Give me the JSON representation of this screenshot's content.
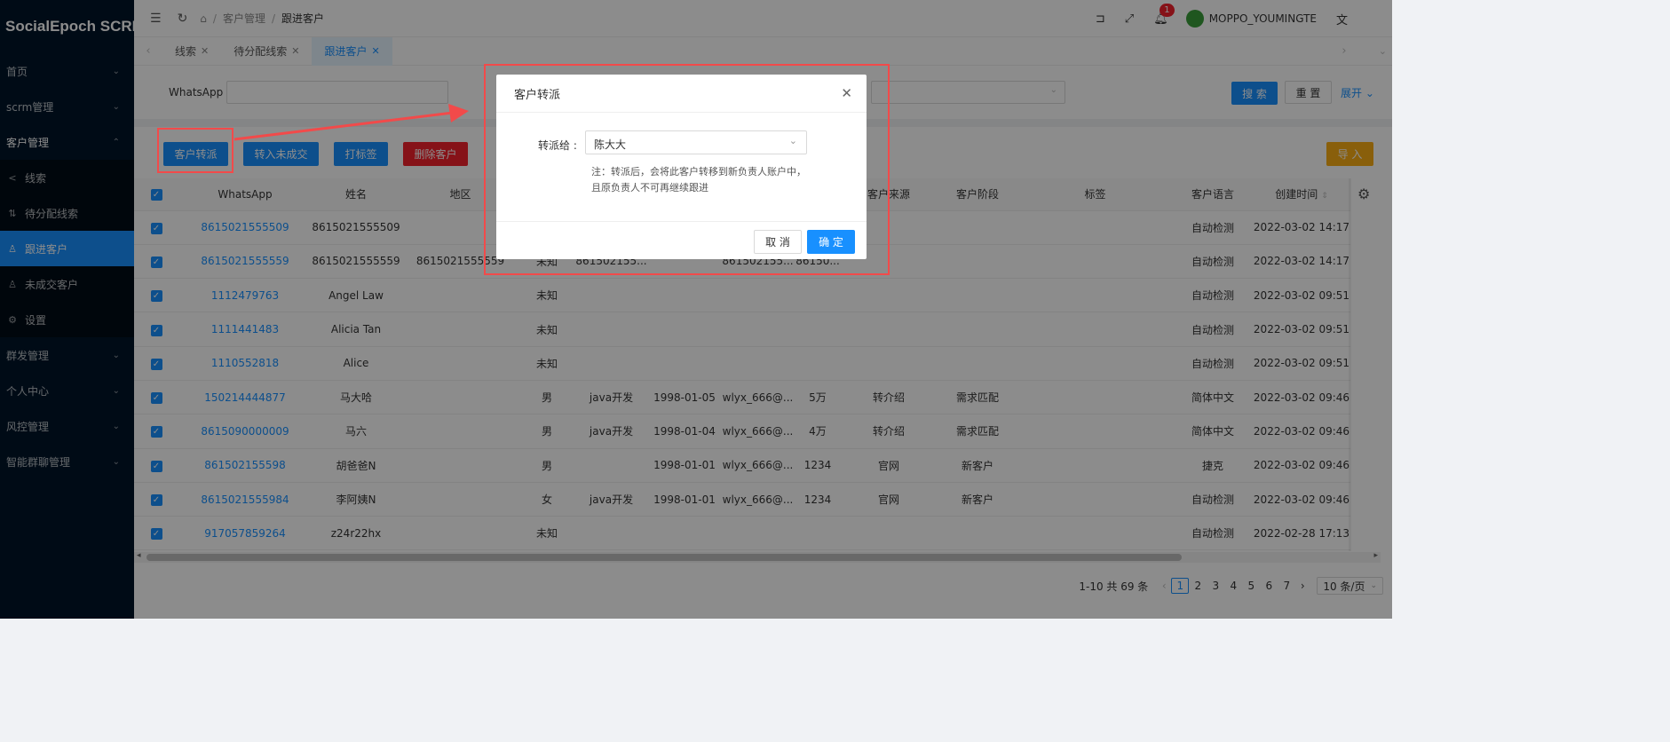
{
  "brand": {
    "logo_text": "SocialEpoch SCRM"
  },
  "sidebar": {
    "items": [
      {
        "label": "首页"
      },
      {
        "label": "scrm管理"
      },
      {
        "label": "客户管理"
      },
      {
        "label": "群发管理"
      },
      {
        "label": "个人中心"
      },
      {
        "label": "风控管理"
      },
      {
        "label": "智能群聊管理"
      }
    ],
    "submenu": [
      {
        "label": "线索",
        "icon": "share-icon"
      },
      {
        "label": "待分配线索",
        "icon": "transfer-icon"
      },
      {
        "label": "跟进客户",
        "icon": "user-icon",
        "active": true
      },
      {
        "label": "未成交客户",
        "icon": "user-icon"
      },
      {
        "label": "设置",
        "icon": "gear-icon"
      }
    ]
  },
  "header": {
    "breadcrumb": [
      "客户管理",
      "跟进客户"
    ],
    "notification_count": "1",
    "username": "MOPPO_YOUMINGTE"
  },
  "tabs": [
    {
      "label": "线索"
    },
    {
      "label": "待分配线索"
    },
    {
      "label": "跟进客户",
      "active": true
    }
  ],
  "filter": {
    "whatsapp_label": "WhatsApp :",
    "search_label": "搜 索",
    "reset_label": "重 置",
    "expand_label": "展开"
  },
  "toolbar": {
    "transfer_label": "客户转派",
    "to_unclosed_label": "转入未成交",
    "tag_label": "打标签",
    "delete_label": "删除客户",
    "import_label": "导 入"
  },
  "table": {
    "columns": [
      "WhatsApp",
      "姓名",
      "地区",
      "",
      "",
      "",
      "",
      "",
      "客户来源",
      "客户阶段",
      "标签",
      "客户语言",
      "创建时间"
    ],
    "rows": [
      [
        "8615021555509",
        "8615021555509",
        "",
        "",
        "",
        "",
        "",
        "",
        "",
        "",
        "",
        "自动检测",
        "2022-03-02 14:17"
      ],
      [
        "8615021555559",
        "8615021555559",
        "8615021555559",
        "未知",
        "861502155...",
        "",
        "861502155...",
        "86150...",
        "",
        "",
        "",
        "自动检测",
        "2022-03-02 14:17"
      ],
      [
        "1112479763",
        "Angel Law",
        "",
        "未知",
        "",
        "",
        "",
        "",
        "",
        "",
        "",
        "自动检测",
        "2022-03-02 09:51"
      ],
      [
        "1111441483",
        "Alicia Tan",
        "",
        "未知",
        "",
        "",
        "",
        "",
        "",
        "",
        "",
        "自动检测",
        "2022-03-02 09:51"
      ],
      [
        "1110552818",
        "Alice",
        "",
        "未知",
        "",
        "",
        "",
        "",
        "",
        "",
        "",
        "自动检测",
        "2022-03-02 09:51"
      ],
      [
        "150214444877",
        "马大哈",
        "",
        "男",
        "java开发",
        "1998-01-05",
        "wlyx_666@...",
        "5万",
        "转介绍",
        "需求匹配",
        "",
        "简体中文",
        "2022-03-02 09:46"
      ],
      [
        "8615090000009",
        "马六",
        "",
        "男",
        "java开发",
        "1998-01-04",
        "wlyx_666@...",
        "4万",
        "转介绍",
        "需求匹配",
        "",
        "简体中文",
        "2022-03-02 09:46"
      ],
      [
        "861502155598",
        "胡爸爸N",
        "",
        "男",
        "",
        "1998-01-01",
        "wlyx_666@...",
        "1234",
        "官网",
        "新客户",
        "",
        "捷克",
        "2022-03-02 09:46"
      ],
      [
        "8615021555984",
        "李阿姨N",
        "",
        "女",
        "java开发",
        "1998-01-01",
        "wlyx_666@...",
        "1234",
        "官网",
        "新客户",
        "",
        "自动检测",
        "2022-03-02 09:46"
      ],
      [
        "917057859264",
        "z24r22hx",
        "",
        "未知",
        "",
        "",
        "",
        "",
        "",
        "",
        "",
        "自动检测",
        "2022-02-28 17:13"
      ]
    ]
  },
  "pagination": {
    "total": "1-10 共 69 条",
    "pages": [
      "1",
      "2",
      "3",
      "4",
      "5",
      "6",
      "7"
    ],
    "current": "1",
    "page_size": "10 条/页"
  },
  "modal": {
    "title": "客户转派",
    "assign_label": "转派给 :",
    "assignee_value": "陈大大",
    "note": "注：转派后，会将此客户转移到新负责人账户中，且原负责人不可再继续跟进",
    "cancel_label": "取 消",
    "ok_label": "确 定"
  },
  "colors": {
    "primary": "#1890ff",
    "danger": "#f5222d",
    "warning": "#faad14",
    "sidebar": "#001529",
    "annotation": "#f24a4a"
  }
}
